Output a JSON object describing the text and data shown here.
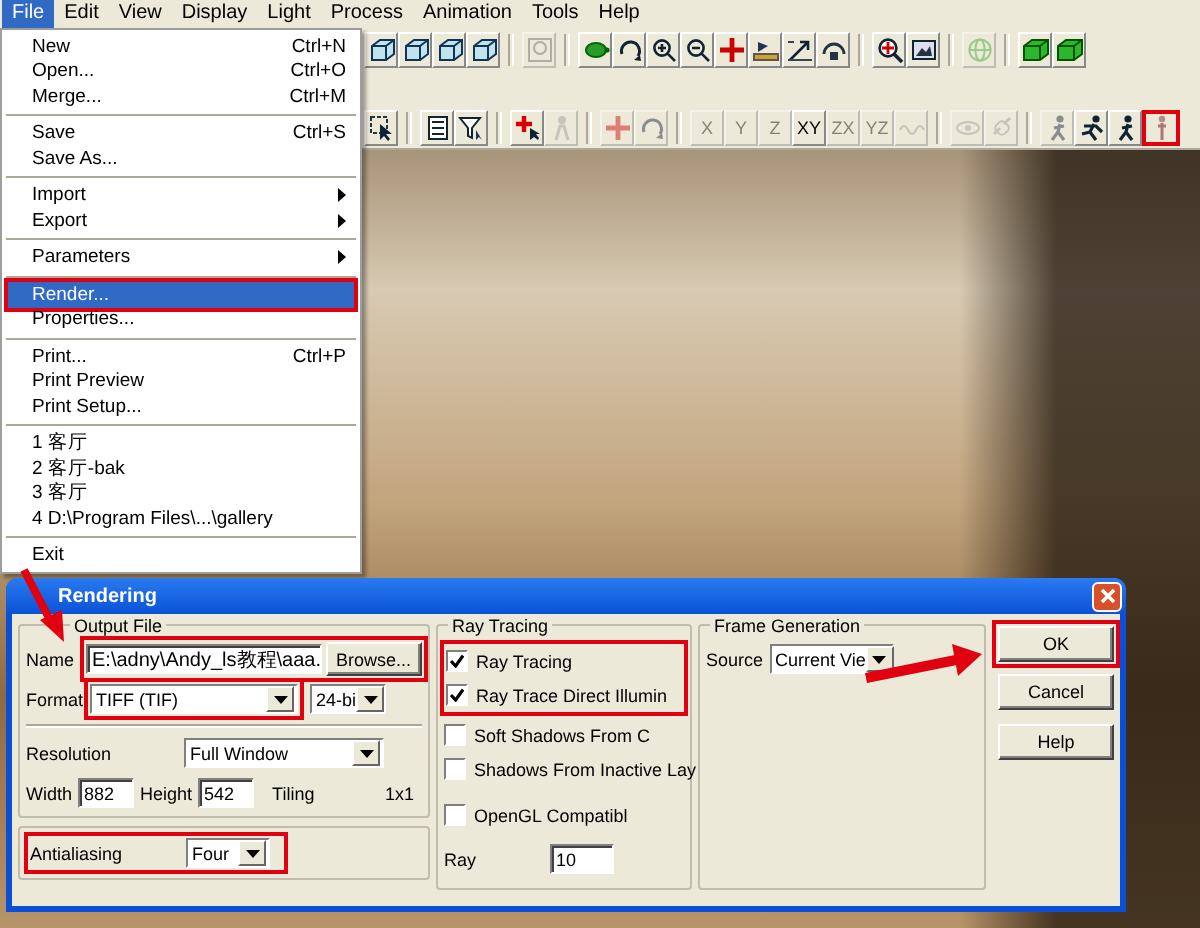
{
  "menu_bar": [
    {
      "label": "File",
      "selected": true
    },
    {
      "label": "Edit",
      "selected": false
    },
    {
      "label": "View",
      "selected": false
    },
    {
      "label": "Display",
      "selected": false
    },
    {
      "label": "Light",
      "selected": false
    },
    {
      "label": "Process",
      "selected": false
    },
    {
      "label": "Animation",
      "selected": false
    },
    {
      "label": "Tools",
      "selected": false
    },
    {
      "label": "Help",
      "selected": false
    }
  ],
  "toolbars": [
    {
      "buttons": [
        {
          "kind": "cube",
          "disabled": false,
          "highlighted": false
        },
        {
          "kind": "cube",
          "disabled": false,
          "highlighted": false
        },
        {
          "kind": "cube",
          "disabled": false,
          "highlighted": false
        },
        {
          "kind": "cube",
          "disabled": false,
          "highlighted": false
        },
        {
          "kind": "separator"
        },
        {
          "kind": "zoom-window",
          "disabled": true,
          "highlighted": false
        },
        {
          "kind": "separator"
        },
        {
          "kind": "turtle",
          "disabled": false,
          "highlighted": false
        },
        {
          "kind": "rotate",
          "disabled": false,
          "highlighted": false
        },
        {
          "kind": "zoom-in",
          "disabled": false,
          "highlighted": false
        },
        {
          "kind": "zoom-out",
          "disabled": false,
          "highlighted": false
        },
        {
          "kind": "move",
          "disabled": false,
          "highlighted": false
        },
        {
          "kind": "floor",
          "disabled": false,
          "highlighted": false
        },
        {
          "kind": "zoom-extent",
          "disabled": false,
          "highlighted": false
        },
        {
          "kind": "orbit",
          "disabled": false,
          "highlighted": false
        },
        {
          "kind": "separator"
        },
        {
          "kind": "magnify",
          "disabled": false,
          "highlighted": false
        },
        {
          "kind": "picture",
          "disabled": false,
          "highlighted": false
        },
        {
          "kind": "separator"
        },
        {
          "kind": "sphere",
          "disabled": true,
          "highlighted": false
        },
        {
          "kind": "separator"
        },
        {
          "kind": "solid-cube",
          "disabled": false,
          "highlighted": false
        },
        {
          "kind": "solid-cube",
          "disabled": false,
          "highlighted": false
        }
      ]
    },
    {
      "buttons": [
        {
          "kind": "select",
          "disabled": false,
          "highlighted": false
        },
        {
          "kind": "separator"
        },
        {
          "kind": "list",
          "disabled": false,
          "highlighted": false
        },
        {
          "kind": "filter",
          "disabled": false,
          "highlighted": false
        },
        {
          "kind": "separator"
        },
        {
          "kind": "add",
          "disabled": false,
          "highlighted": false
        },
        {
          "kind": "person",
          "disabled": true,
          "highlighted": false
        },
        {
          "kind": "separator"
        },
        {
          "kind": "move",
          "disabled": true,
          "highlighted": false
        },
        {
          "kind": "rotate",
          "disabled": true,
          "highlighted": false
        },
        {
          "kind": "separator"
        },
        {
          "kind": "text",
          "label": "X",
          "disabled": true,
          "highlighted": false
        },
        {
          "kind": "text",
          "label": "Y",
          "disabled": true,
          "highlighted": false
        },
        {
          "kind": "text",
          "label": "Z",
          "disabled": true,
          "highlighted": false
        },
        {
          "kind": "text",
          "label": "XY",
          "disabled": false,
          "highlighted": false
        },
        {
          "kind": "text",
          "label": "ZX",
          "disabled": true,
          "highlighted": false
        },
        {
          "kind": "text",
          "label": "YZ",
          "disabled": true,
          "highlighted": false
        },
        {
          "kind": "wave",
          "disabled": true,
          "highlighted": false
        },
        {
          "kind": "separator"
        },
        {
          "kind": "eye",
          "disabled": true,
          "highlighted": false
        },
        {
          "kind": "link",
          "disabled": true,
          "highlighted": false
        },
        {
          "kind": "separator"
        },
        {
          "kind": "walker",
          "disabled": true,
          "highlighted": false
        },
        {
          "kind": "runner",
          "disabled": false,
          "highlighted": false
        },
        {
          "kind": "walker",
          "disabled": false,
          "highlighted": false
        },
        {
          "kind": "figure",
          "disabled": false,
          "highlighted": true
        }
      ]
    }
  ],
  "file_menu": {
    "items": [
      {
        "kind": "item",
        "label": "New",
        "shortcut": "Ctrl+N",
        "submenu": false,
        "selected": false,
        "highlighted": false
      },
      {
        "kind": "item",
        "label": "Open...",
        "shortcut": "Ctrl+O",
        "submenu": false,
        "selected": false,
        "highlighted": false
      },
      {
        "kind": "item",
        "label": "Merge...",
        "shortcut": "Ctrl+M",
        "submenu": false,
        "selected": false,
        "highlighted": false
      },
      {
        "kind": "separator"
      },
      {
        "kind": "item",
        "label": "Save",
        "shortcut": "Ctrl+S",
        "submenu": false,
        "selected": false,
        "highlighted": false
      },
      {
        "kind": "item",
        "label": "Save As...",
        "submenu": false,
        "selected": false,
        "highlighted": false
      },
      {
        "kind": "separator"
      },
      {
        "kind": "item",
        "label": "Import",
        "submenu": true,
        "selected": false,
        "highlighted": false
      },
      {
        "kind": "item",
        "label": "Export",
        "submenu": true,
        "selected": false,
        "highlighted": false
      },
      {
        "kind": "separator"
      },
      {
        "kind": "item",
        "label": "Parameters",
        "submenu": true,
        "selected": false,
        "highlighted": false
      },
      {
        "kind": "separator"
      },
      {
        "kind": "item",
        "label": "Render...",
        "submenu": false,
        "selected": true,
        "highlighted": true
      },
      {
        "kind": "item",
        "label": "Properties...",
        "submenu": false,
        "selected": false,
        "highlighted": false
      },
      {
        "kind": "separator"
      },
      {
        "kind": "item",
        "label": "Print...",
        "shortcut": "Ctrl+P",
        "submenu": false,
        "selected": false,
        "highlighted": false
      },
      {
        "kind": "item",
        "label": "Print Preview",
        "submenu": false,
        "selected": false,
        "highlighted": false
      },
      {
        "kind": "item",
        "label": "Print Setup...",
        "submenu": false,
        "selected": false,
        "highlighted": false
      },
      {
        "kind": "separator"
      },
      {
        "kind": "item",
        "label": "1 客厅",
        "submenu": false,
        "selected": false,
        "highlighted": false
      },
      {
        "kind": "item",
        "label": "2 客厅-bak",
        "submenu": false,
        "selected": false,
        "highlighted": false
      },
      {
        "kind": "item",
        "label": "3 客厅",
        "submenu": false,
        "selected": false,
        "highlighted": false
      },
      {
        "kind": "item",
        "label": "4 D:\\Program Files\\...\\gallery",
        "submenu": false,
        "selected": false,
        "highlighted": false
      },
      {
        "kind": "separator"
      },
      {
        "kind": "item",
        "label": "Exit",
        "submenu": false,
        "selected": false,
        "highlighted": false
      }
    ]
  },
  "dialog": {
    "title": "Rendering",
    "output_file": {
      "title": "Output File",
      "name_label": "Name",
      "name_value": "E:\\adny\\Andy_ls教程\\aaa.",
      "name_highlighted": true,
      "browse_button": "Browse...",
      "format_label": "Format",
      "format_value": "TIFF (TIF)",
      "format_highlighted": true,
      "depth_value": "24-bi",
      "resolution_label": "Resolution",
      "resolution_value": "Full Window",
      "width_label": "Width",
      "width_value": "882",
      "height_label": "Height",
      "height_value": "542",
      "tiling_label": "Tiling",
      "tiling_value": "1x1"
    },
    "antialiasing": {
      "label": "Antialiasing",
      "value": "Four",
      "highlighted": true
    },
    "ray_tracing": {
      "title": "Ray Tracing",
      "options": [
        {
          "label": "Ray Tracing",
          "checked": true,
          "highlighted": true
        },
        {
          "label": "Ray Trace Direct Illumin",
          "checked": true,
          "highlighted": true
        },
        {
          "label": "Soft Shadows From C",
          "checked": false,
          "highlighted": false
        },
        {
          "label": "Shadows From Inactive Lay",
          "checked": false,
          "highlighted": false
        },
        {
          "label": "OpenGL Compatibl",
          "checked": false,
          "highlighted": false
        }
      ],
      "ray_label": "Ray",
      "ray_value": "10"
    },
    "frame_generation": {
      "title": "Frame Generation",
      "source_label": "Source",
      "source_value": "Current Vie"
    },
    "buttons": [
      {
        "label": "OK",
        "highlighted": true
      },
      {
        "label": "Cancel",
        "highlighted": false
      },
      {
        "label": "Help",
        "highlighted": false
      }
    ]
  }
}
